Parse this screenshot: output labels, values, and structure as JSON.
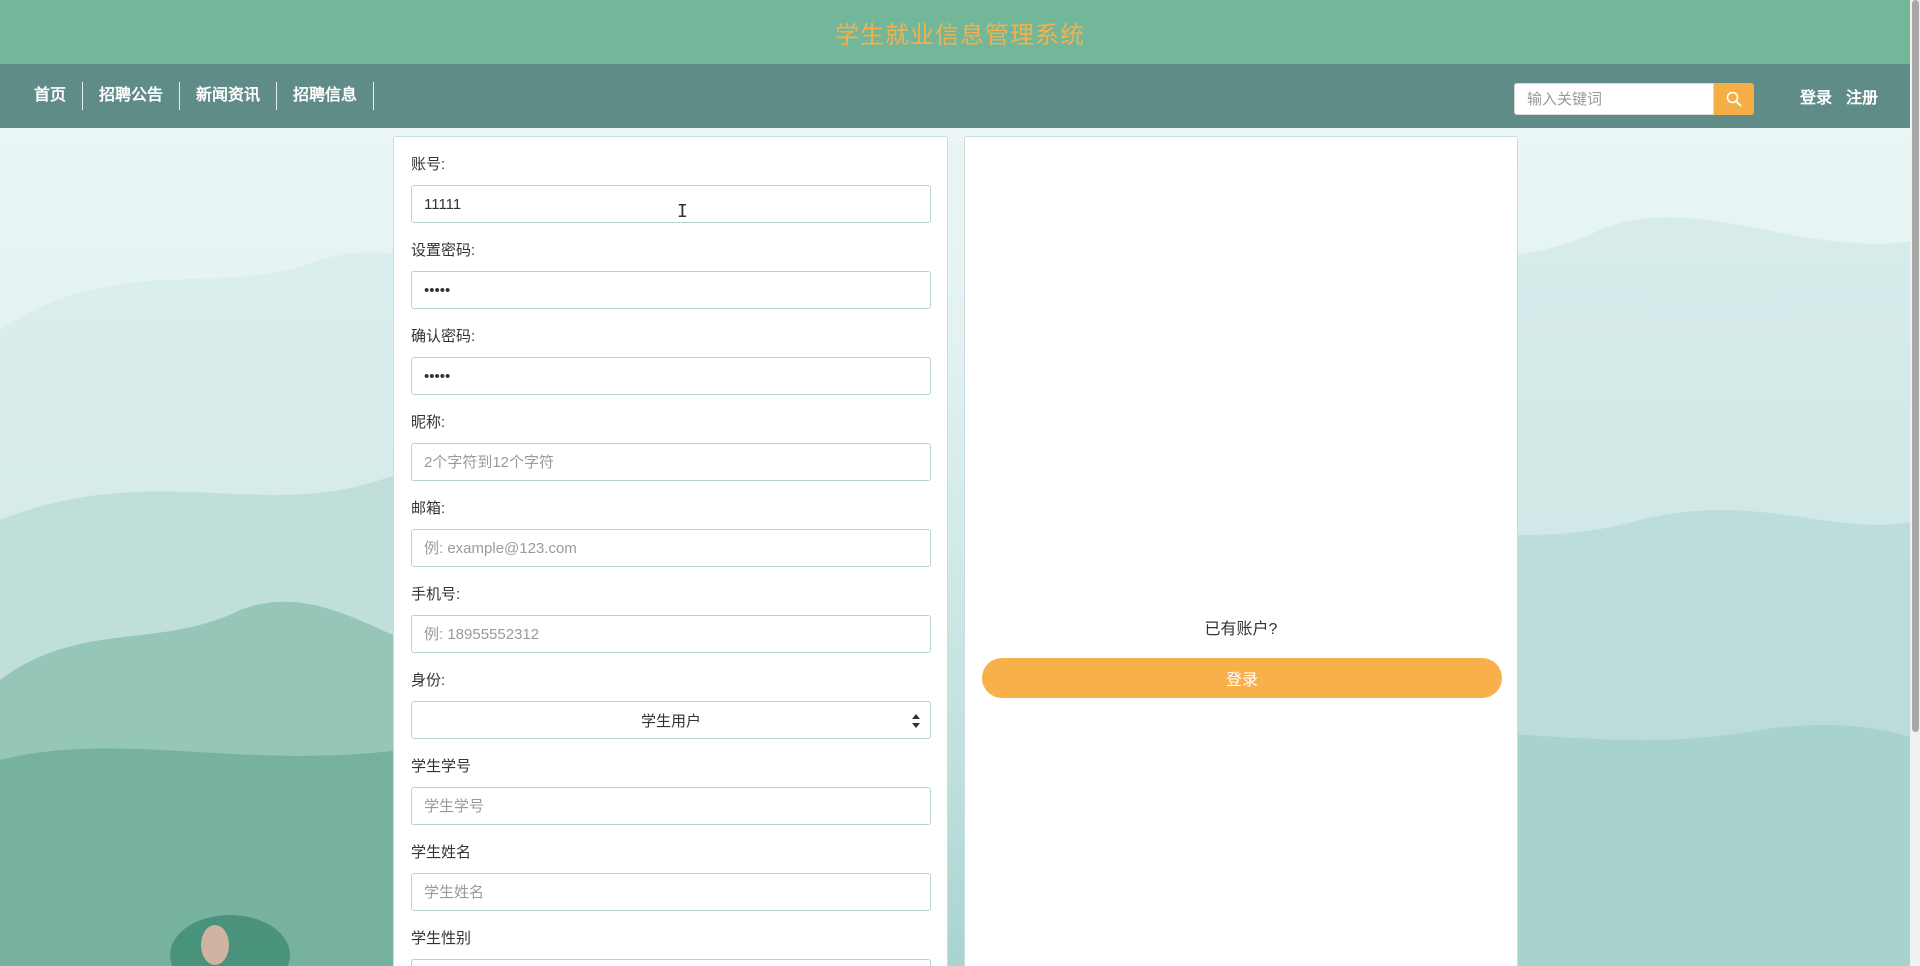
{
  "header": {
    "site_title": "学生就业信息管理系统"
  },
  "nav": {
    "items": [
      {
        "label": "首页"
      },
      {
        "label": "招聘公告"
      },
      {
        "label": "新闻资讯"
      },
      {
        "label": "招聘信息"
      }
    ],
    "search": {
      "placeholder": "输入关键词",
      "icon": "search-icon"
    },
    "login_label": "登录",
    "register_label": "注册"
  },
  "form": {
    "fields": [
      {
        "label": "账号:",
        "value": "11111",
        "placeholder": ""
      },
      {
        "label": "设置密码:",
        "value": "•••••",
        "placeholder": ""
      },
      {
        "label": "确认密码:",
        "value": "•••••",
        "placeholder": ""
      },
      {
        "label": "昵称:",
        "value": "",
        "placeholder": "2个字符到12个字符"
      },
      {
        "label": "邮箱:",
        "value": "",
        "placeholder": "例: example@123.com"
      },
      {
        "label": "手机号:",
        "value": "",
        "placeholder": "例: 18955552312"
      },
      {
        "label": "身份:",
        "selected": "学生用户"
      },
      {
        "label": "学生学号",
        "value": "",
        "placeholder": "学生学号"
      },
      {
        "label": "学生姓名",
        "value": "",
        "placeholder": "学生姓名"
      },
      {
        "label": "学生性别"
      }
    ]
  },
  "side": {
    "has_account_text": "已有账户?",
    "login_button_label": "登录"
  },
  "colors": {
    "title_bar": "#72b79a",
    "nav_bar": "#5f8c86",
    "accent": "#f8b04a",
    "title_text": "#f6b04a"
  }
}
